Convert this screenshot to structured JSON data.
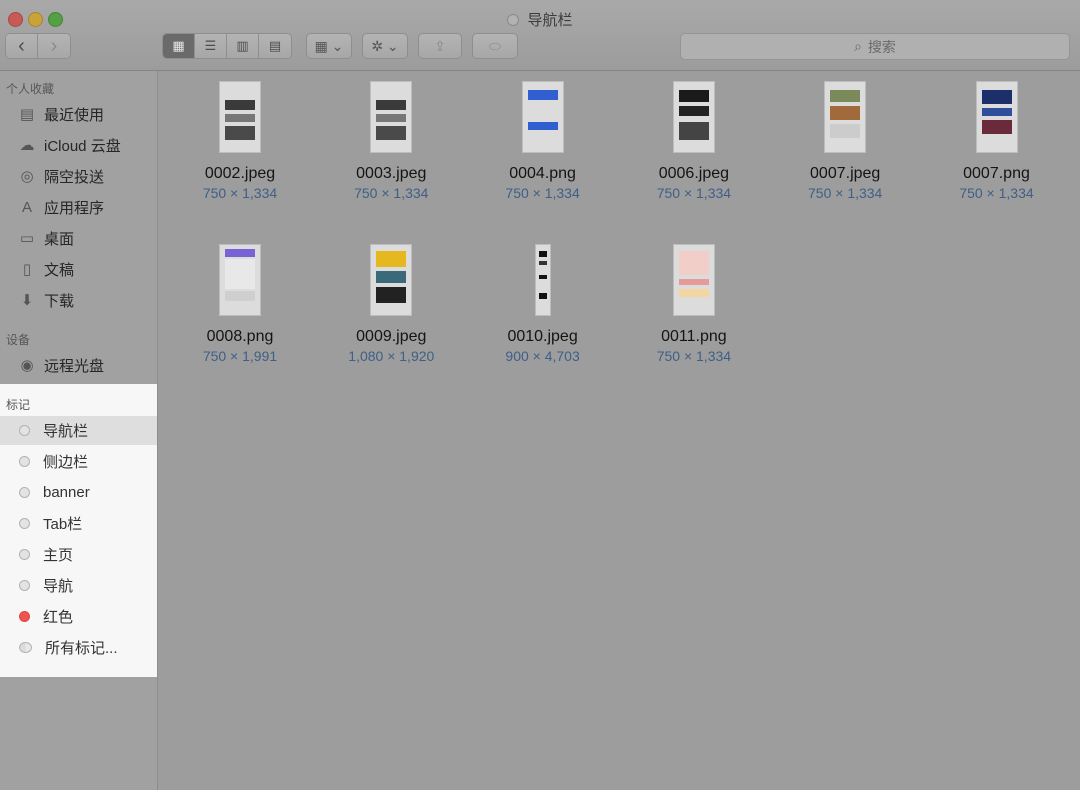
{
  "window": {
    "title": "导航栏"
  },
  "toolbar": {
    "nav": [
      {
        "name": "back-button",
        "glyph": "‹"
      },
      {
        "name": "forward-button",
        "glyph": "›"
      }
    ],
    "view_modes": [
      {
        "name": "icon-view-button",
        "glyph": "▦",
        "active": true
      },
      {
        "name": "list-view-button",
        "glyph": "☰",
        "active": false
      },
      {
        "name": "column-view-button",
        "glyph": "▥",
        "active": false
      },
      {
        "name": "gallery-view-button",
        "glyph": "▤",
        "active": false
      }
    ],
    "arrange_glyph": "▦ ⌄",
    "action_glyph": "✲ ⌄",
    "share_glyph": "⇪",
    "tag_glyph": "⬭",
    "search_placeholder": "搜索",
    "search_icon": "⌕"
  },
  "sidebar": {
    "favorites_header": "个人收藏",
    "favorites": [
      {
        "label": "最近使用",
        "icon": "clock-icon",
        "glyph": "▤"
      },
      {
        "label": "iCloud 云盘",
        "icon": "cloud-icon",
        "glyph": "☁"
      },
      {
        "label": "隔空投送",
        "icon": "airdrop-icon",
        "glyph": "◎"
      },
      {
        "label": "应用程序",
        "icon": "applications-icon",
        "glyph": "A"
      },
      {
        "label": "桌面",
        "icon": "desktop-icon",
        "glyph": "▭"
      },
      {
        "label": "文稿",
        "icon": "documents-icon",
        "glyph": "▯"
      },
      {
        "label": "下载",
        "icon": "download-icon",
        "glyph": "⬇"
      }
    ],
    "devices_header": "设备",
    "devices": [
      {
        "label": "远程光盘",
        "icon": "disc-icon",
        "glyph": "◉"
      }
    ],
    "tags_header": "标记",
    "tags": [
      {
        "label": "导航栏",
        "color": "none",
        "selected": true
      },
      {
        "label": "侧边栏",
        "color": "none",
        "selected": false
      },
      {
        "label": "banner",
        "color": "none",
        "selected": false
      },
      {
        "label": "Tab栏",
        "color": "none",
        "selected": false
      },
      {
        "label": "主页",
        "color": "none",
        "selected": false
      },
      {
        "label": "导航",
        "color": "none",
        "selected": false
      },
      {
        "label": "红色",
        "color": "#ef5350",
        "selected": false
      },
      {
        "label": "所有标记...",
        "color": "all",
        "selected": false
      }
    ]
  },
  "files": [
    {
      "name": "0002.jpeg",
      "dims": "750 × 1,334",
      "style": "dark"
    },
    {
      "name": "0003.jpeg",
      "dims": "750 × 1,334",
      "style": "dark"
    },
    {
      "name": "0004.png",
      "dims": "750 × 1,334",
      "style": "blue"
    },
    {
      "name": "0006.jpeg",
      "dims": "750 × 1,334",
      "style": "black"
    },
    {
      "name": "0007.jpeg",
      "dims": "750 × 1,334",
      "style": "food"
    },
    {
      "name": "0007.png",
      "dims": "750 × 1,334",
      "style": "navy"
    },
    {
      "name": "0008.png",
      "dims": "750 × 1,991",
      "style": "purple"
    },
    {
      "name": "0009.jpeg",
      "dims": "1,080 × 1,920",
      "style": "yellow"
    },
    {
      "name": "0010.jpeg",
      "dims": "900 × 4,703",
      "style": "tall"
    },
    {
      "name": "0011.png",
      "dims": "750 × 1,334",
      "style": "pink"
    }
  ]
}
